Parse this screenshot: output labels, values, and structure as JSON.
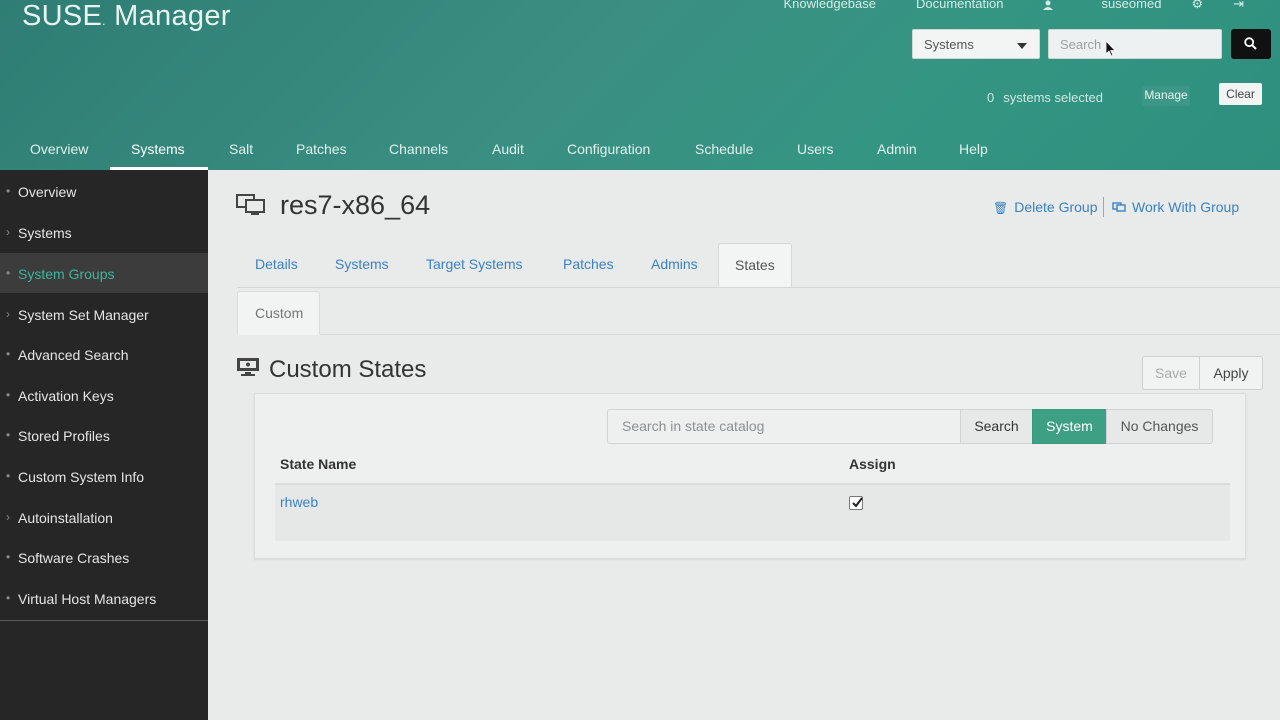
{
  "brand": {
    "name": "SUSE",
    "mark": ".",
    "product": "Manager"
  },
  "toplinks": {
    "knowledgebase": "Knowledgebase",
    "documentation": "Documentation",
    "user": "suseomed"
  },
  "search": {
    "scope": "Systems",
    "placeholder": "Search"
  },
  "selection": {
    "count": "0",
    "label": "systems selected",
    "manage": "Manage",
    "clear": "Clear"
  },
  "nav": [
    "Overview",
    "Systems",
    "Salt",
    "Patches",
    "Channels",
    "Audit",
    "Configuration",
    "Schedule",
    "Users",
    "Admin",
    "Help"
  ],
  "nav_active": "Systems",
  "sidebar": [
    "Overview",
    "Systems",
    "System Groups",
    "System Set Manager",
    "Advanced Search",
    "Activation Keys",
    "Stored Profiles",
    "Custom System Info",
    "Autoinstallation",
    "Software Crashes",
    "Virtual Host Managers"
  ],
  "sidebar_active": "System Groups",
  "page": {
    "title": "res7-x86_64",
    "delete_group": "Delete Group",
    "work_with_group": "Work With Group",
    "tabs": [
      "Details",
      "Systems",
      "Target Systems",
      "Patches",
      "Admins",
      "States"
    ],
    "active_tab": "States",
    "subtab": "Custom",
    "section_title": "Custom States",
    "save": "Save",
    "apply": "Apply"
  },
  "states": {
    "search_placeholder": "Search in state catalog",
    "search_btn": "Search",
    "system_btn": "System",
    "nochange_btn": "No Changes",
    "col_name": "State Name",
    "col_assign": "Assign",
    "rows": [
      {
        "name": "rhweb",
        "assigned": true
      }
    ]
  },
  "colors": {
    "accent": "#3d9f83",
    "header": "#2f8f7e",
    "link": "#3a82c4",
    "sidebar": "#262626"
  }
}
